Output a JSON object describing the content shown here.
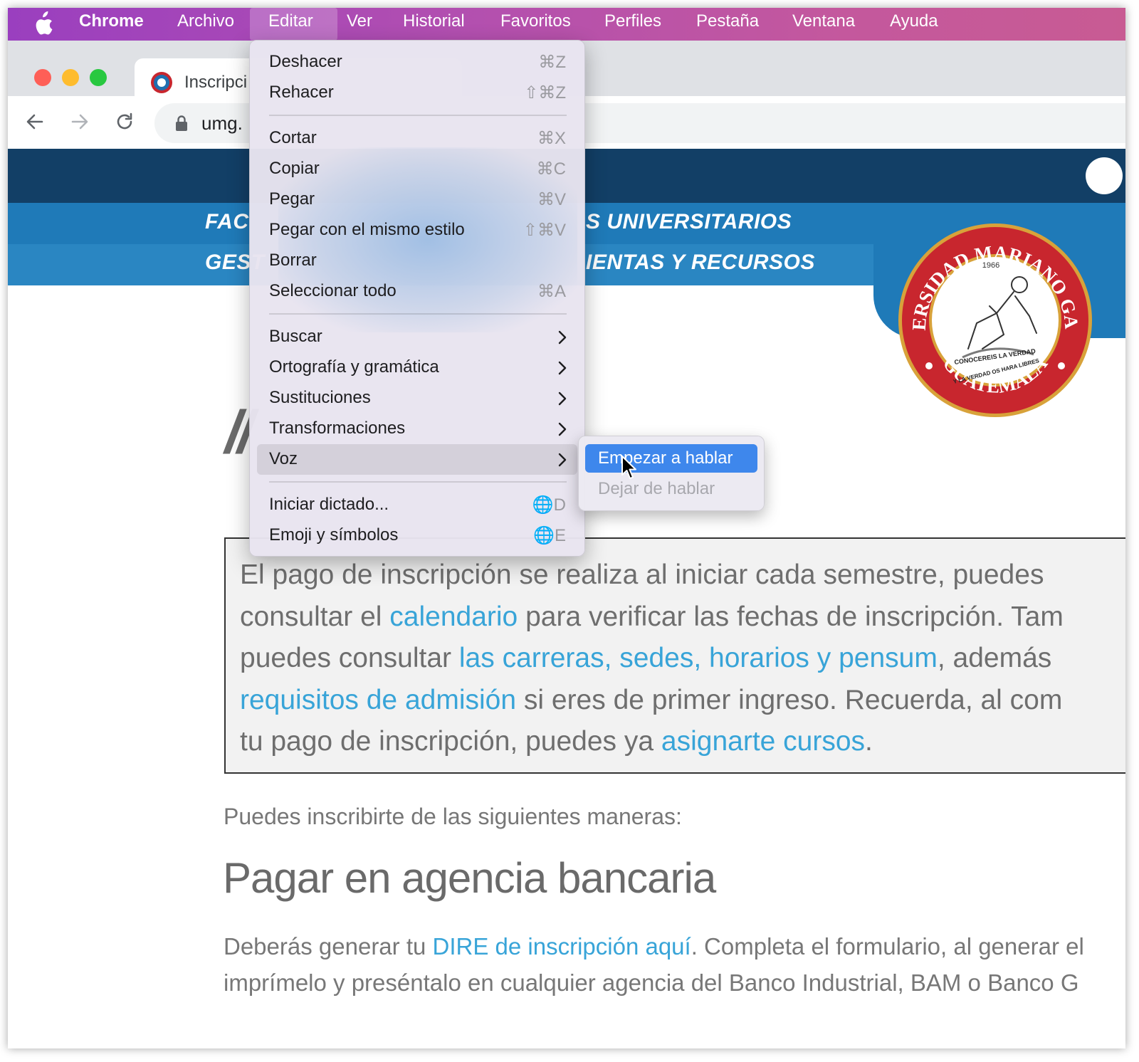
{
  "menubar": {
    "app": "Chrome",
    "items": [
      "Archivo",
      "Editar",
      "Ver",
      "Historial",
      "Favoritos",
      "Perfiles",
      "Pestaña",
      "Ventana",
      "Ayuda"
    ],
    "active": "Editar"
  },
  "browser": {
    "tab_title": "Inscripci",
    "url": "umg."
  },
  "website": {
    "nav_row1_left": "FAC",
    "nav_row1_right": "S UNIVERSITARIOS",
    "nav_row2_left": "GEST",
    "nav_row2_right": "IENTAS Y RECURSOS",
    "heading_fragment": "//",
    "info": {
      "t1": "El pago de inscripción se realiza al iniciar cada semestre, puedes",
      "t2": "consultar el ",
      "link_calendario": "calendario",
      "t3": " para verificar las fechas de inscripción. Tam",
      "t4": "puedes consultar ",
      "link_carreras": "las carreras",
      "t5": ", ",
      "link_sedes": "sedes",
      "t6": ", ",
      "link_horarios": "horarios y pensum",
      "t7": ", además",
      "link_requisitos": "requisitos de admisión",
      "t8": " si eres de primer ingreso. Recuerda, al com",
      "t9": "tu pago de inscripción, puedes ya ",
      "link_cursos": "asignarte cursos",
      "t10": "."
    },
    "intro": "Puedes inscribirte de las siguientes maneras:",
    "section_title": "Pagar en agencia bancaria",
    "para": {
      "p1": "Deberás generar tu ",
      "link_dire": "DIRE de inscripción aquí",
      "p2": ". Completa el formulario, al generar el",
      "p3": "imprímelo y preséntalo en cualquier agencia del Banco Industrial, BAM o Banco G"
    }
  },
  "edit_menu": {
    "items": [
      {
        "label": "Deshacer",
        "shortcut": "⌘Z"
      },
      {
        "label": "Rehacer",
        "shortcut": "⇧⌘Z"
      },
      {
        "label": "Cortar",
        "shortcut": "⌘X"
      },
      {
        "label": "Copiar",
        "shortcut": "⌘C"
      },
      {
        "label": "Pegar",
        "shortcut": "⌘V"
      },
      {
        "label": "Pegar con el mismo estilo",
        "shortcut": "⇧⌘V"
      },
      {
        "label": "Borrar",
        "shortcut": ""
      },
      {
        "label": "Seleccionar todo",
        "shortcut": "⌘A"
      },
      {
        "label": "Buscar"
      },
      {
        "label": "Ortografía y gramática"
      },
      {
        "label": "Sustituciones"
      },
      {
        "label": "Transformaciones"
      },
      {
        "label": "Voz"
      },
      {
        "label": "Iniciar dictado...",
        "shortcut": "🌐D"
      },
      {
        "label": "Emoji y símbolos",
        "shortcut": "🌐E"
      }
    ],
    "highlighted": "Voz"
  },
  "voice_submenu": {
    "items": [
      {
        "label": "Empezar a hablar",
        "state": "selected"
      },
      {
        "label": "Dejar de hablar",
        "state": "disabled"
      }
    ]
  },
  "logo": {
    "text_top": "UNIVERSIDAD MARIANO GALVEZ",
    "text_bottom": "GUATEMALA",
    "year": "1966",
    "motto_1": "CONOCEREIS LA VERDAD",
    "motto_2": "Y LA VERDAD OS HARA LIBRES"
  },
  "colors": {
    "menubar_start": "#9a3fbf",
    "menubar_end": "#c85b93",
    "site_dark_blue": "#123f66",
    "site_blue": "#1f7ab8",
    "link": "#38a4d8",
    "selection": "#3e87ec",
    "seal_red": "#c8262e",
    "seal_gold": "#d8a23a"
  }
}
